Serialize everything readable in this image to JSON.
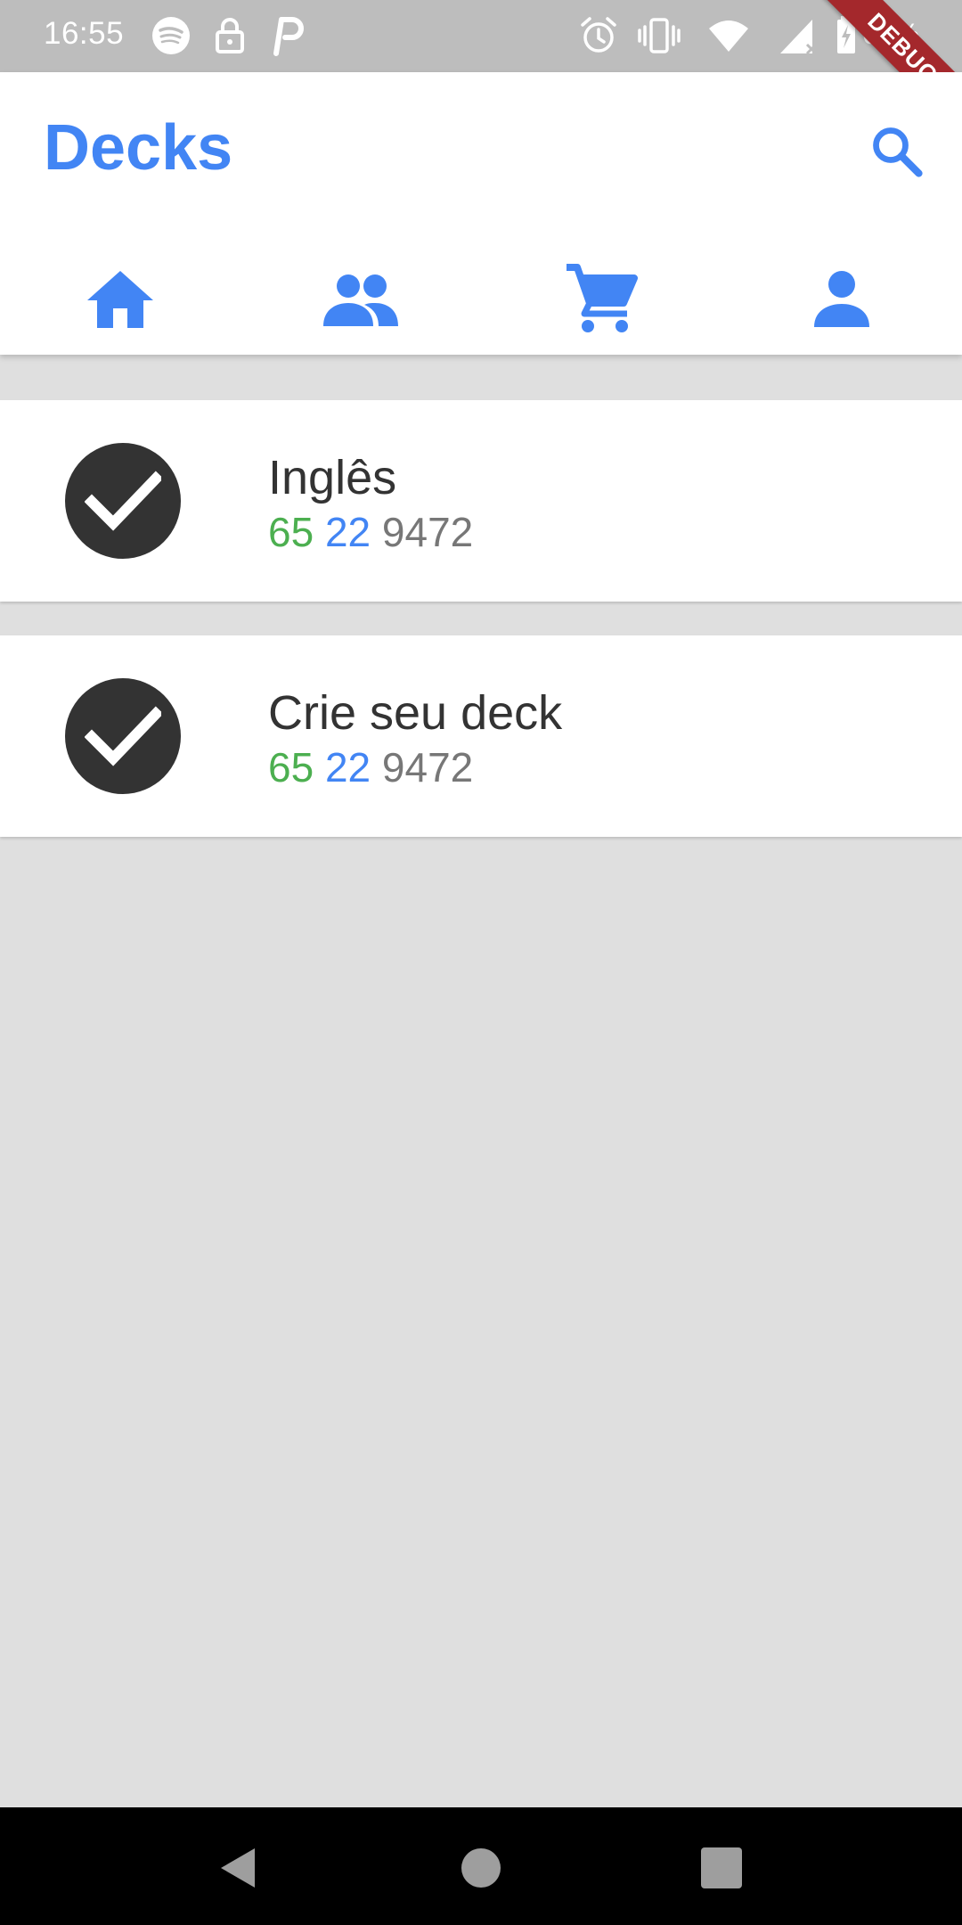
{
  "status_bar": {
    "time": "16:55",
    "battery": "68%",
    "icons": [
      "spotify-icon",
      "lock-icon",
      "parking-icon",
      "alarm-icon",
      "vibrate-icon",
      "wifi-icon",
      "signal-icon",
      "battery-icon"
    ]
  },
  "debug_banner": "DEBUG",
  "app_bar": {
    "title": "Decks",
    "search_icon": "search-icon",
    "tabs": [
      {
        "icon": "home-icon",
        "selected": true
      },
      {
        "icon": "people-icon",
        "selected": false
      },
      {
        "icon": "cart-icon",
        "selected": false
      },
      {
        "icon": "person-icon",
        "selected": false
      }
    ]
  },
  "decks": [
    {
      "name": "Inglês",
      "stats": {
        "green": "65",
        "blue": "22",
        "grey": "9472"
      },
      "icon": "check-circle-icon"
    },
    {
      "name": "Crie seu deck",
      "stats": {
        "green": "65",
        "blue": "22",
        "grey": "9472"
      },
      "icon": "check-circle-icon"
    }
  ],
  "nav_bar": {
    "icons": [
      "back-icon",
      "home-circle-icon",
      "recents-icon"
    ]
  },
  "colors": {
    "accent": "#4285f4",
    "green": "#4caf50",
    "grey_text": "#777777",
    "dark": "#333333",
    "background": "#dfdfdf",
    "status_bar": "#bdbdbd",
    "debug": "#a4282c"
  }
}
